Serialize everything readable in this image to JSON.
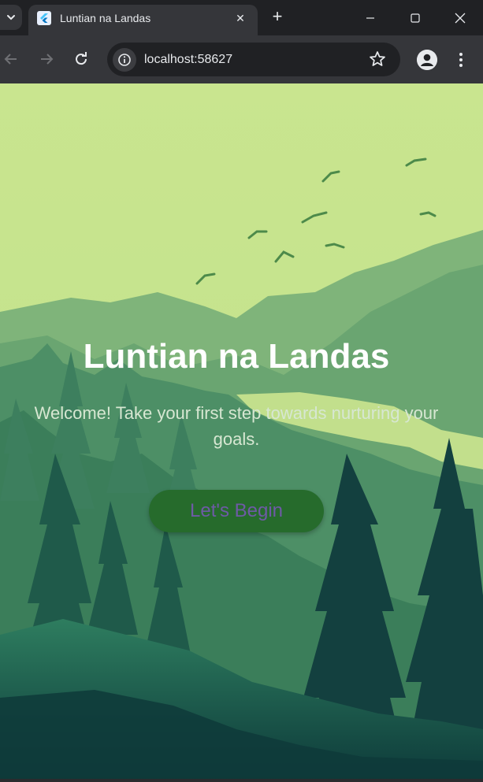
{
  "browser": {
    "tab_title": "Luntian na Landas",
    "url": "localhost:58627",
    "new_tab_symbol": "+",
    "close_symbol": "✕"
  },
  "icons": {
    "tab_search": "chevron-down-icon",
    "favicon": "flutter-icon",
    "back": "back-arrow-icon",
    "forward": "forward-arrow-icon",
    "reload": "reload-icon",
    "site_info": "info-icon",
    "bookmark": "star-icon",
    "profile": "person-icon",
    "menu": "three-dots-icon"
  },
  "page": {
    "title": "Luntian na Landas",
    "subtitle": "Welcome! Take your first step towards nurturing your goals.",
    "cta_label": "Let's Begin"
  },
  "colors": {
    "sky": "#c8e38e",
    "button_bg": "#266b2c",
    "button_text": "#6e5aa6",
    "title": "#ffffff"
  }
}
